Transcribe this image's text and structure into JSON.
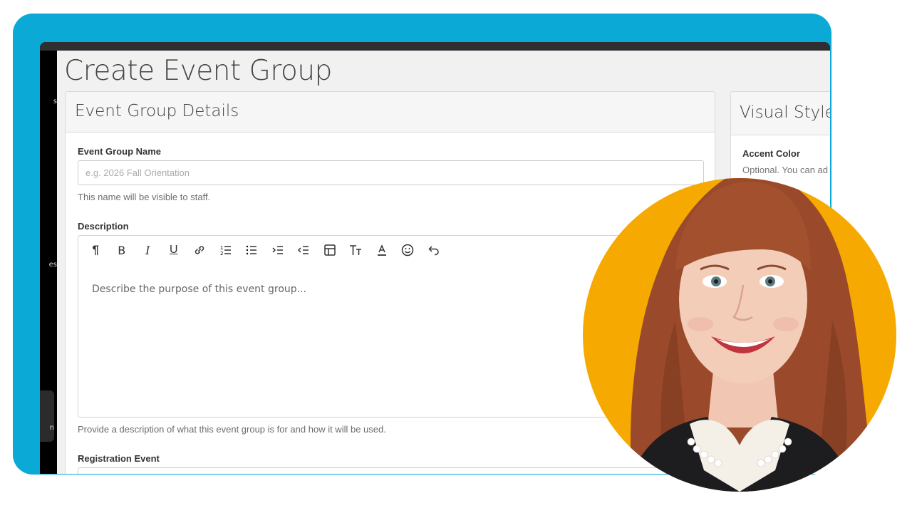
{
  "page": {
    "title": "Create Event Group"
  },
  "sidebar": {
    "items": [
      "s",
      "es",
      "n"
    ]
  },
  "details_card": {
    "title": "Event Group Details",
    "name_label": "Event Group Name",
    "name_placeholder": "e.g. 2026 Fall Orientation",
    "name_help": "This name will be visible to staff.",
    "description_label": "Description",
    "description_placeholder": "Describe the purpose of this event group...",
    "description_help": "Provide a description of what this event group is for and how it will be used.",
    "registration_label": "Registration Event",
    "toolbar": [
      "paragraph-icon",
      "bold-icon",
      "italic-icon",
      "underline-icon",
      "link-icon",
      "ordered-list-icon",
      "bullet-list-icon",
      "indent-icon",
      "outdent-icon",
      "table-icon",
      "text-size-icon",
      "font-color-icon",
      "emoji-icon",
      "undo-icon"
    ]
  },
  "style_card": {
    "title": "Visual Style",
    "accent_label": "Accent Color",
    "accent_help": "Optional. You can ad"
  },
  "colors": {
    "frame": "#0aa9d6",
    "photo_bg": "#f6a900"
  }
}
